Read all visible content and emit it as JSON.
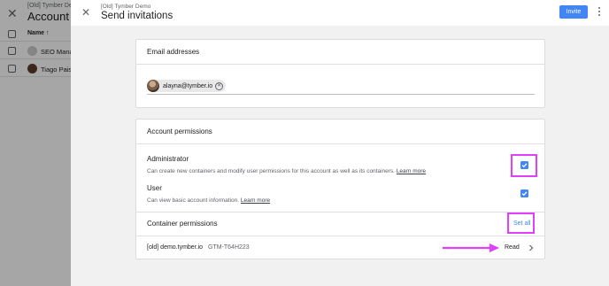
{
  "background": {
    "subtitle": "[Old] Tymber Demo",
    "title": "Account p",
    "column_name": "Name",
    "sort_icon": "arrow-up-icon",
    "rows": [
      {
        "name": "SEO Manag"
      },
      {
        "name": "Tiago Pais"
      }
    ]
  },
  "dialog": {
    "subtitle": "[Old] Tymber Demo",
    "title": "Send invitations",
    "invite_label": "Invite",
    "email_card": {
      "title": "Email addresses",
      "chip_email": "alayna@tymber.io"
    },
    "account_card": {
      "title": "Account permissions",
      "permissions": [
        {
          "label": "Administrator",
          "description": "Can create new containers and modify user permissions for this account as well as its containers.",
          "link": "Learn more",
          "checked": true
        },
        {
          "label": "User",
          "description": "Can view basic account information.",
          "link": "Learn more",
          "checked": true
        }
      ],
      "container_title": "Container permissions",
      "set_all_label": "Set all",
      "containers": [
        {
          "name": "[old] demo.tymber.io",
          "id": "GTM-T64H223",
          "role": "Read"
        }
      ]
    }
  },
  "colors": {
    "accent": "#4285f4",
    "highlight": "#e040fb"
  }
}
